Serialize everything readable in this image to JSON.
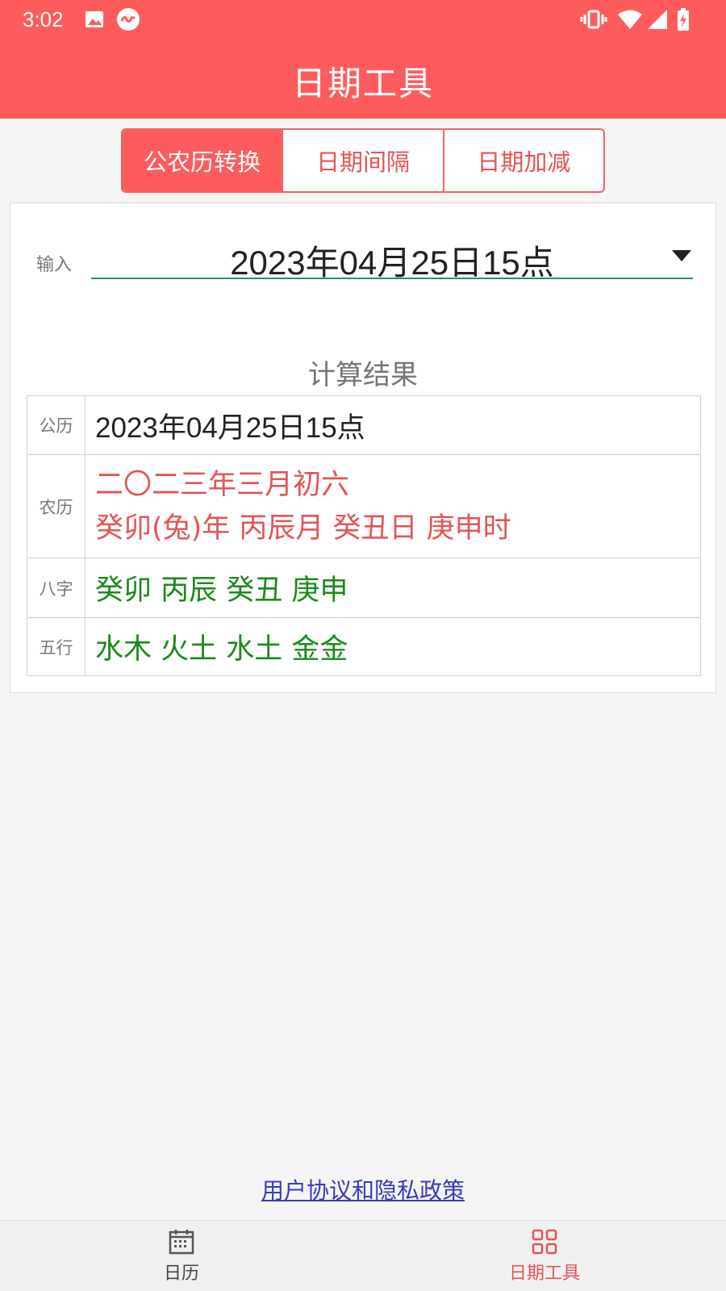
{
  "status_bar": {
    "time": "3:02",
    "icons": [
      "image-icon",
      "app-notification-icon",
      "vibrate-icon",
      "wifi-icon",
      "signal-icon",
      "battery-charging-icon"
    ]
  },
  "app_bar": {
    "title": "日期工具"
  },
  "tabs": [
    {
      "label": "公农历转换",
      "active": true
    },
    {
      "label": "日期间隔",
      "active": false
    },
    {
      "label": "日期加减",
      "active": false
    }
  ],
  "input": {
    "label": "输入",
    "value": "2023年04月25日15点"
  },
  "result": {
    "title": "计算结果",
    "rows": [
      {
        "label": "公历",
        "lines": [
          "2023年04月25日15点"
        ],
        "color": "#222222"
      },
      {
        "label": "农历",
        "lines": [
          "二〇二三年三月初六",
          "癸卯(兔)年 丙辰月 癸丑日 庚申时"
        ],
        "color": "#e45454"
      },
      {
        "label": "八字",
        "lines": [
          "癸卯 丙辰 癸丑 庚申"
        ],
        "color": "#1a8a1a"
      },
      {
        "label": "五行",
        "lines": [
          "水木 火土 水土 金金"
        ],
        "color": "#1a8a1a"
      }
    ]
  },
  "footer": {
    "policy_link": "用户协议和隐私政策"
  },
  "bottom_nav": [
    {
      "label": "日历",
      "icon": "calendar-icon",
      "active": false
    },
    {
      "label": "日期工具",
      "icon": "grid-icon",
      "active": true
    }
  ],
  "colors": {
    "accent": "#fe5c5c",
    "link": "#3a3ac0",
    "green": "#1a8a1a"
  }
}
